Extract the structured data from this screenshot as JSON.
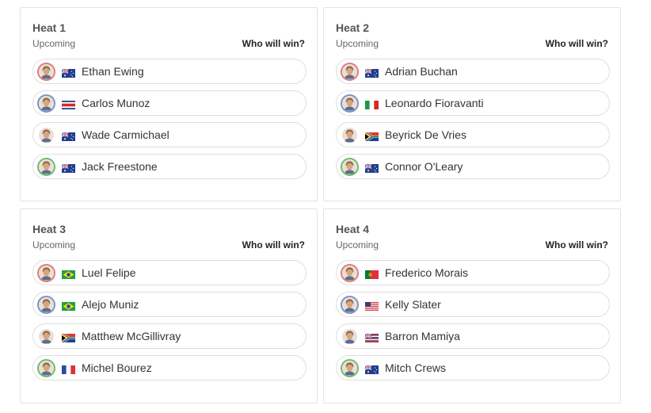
{
  "heats": [
    {
      "title": "Heat 1",
      "status": "Upcoming",
      "prompt": "Who will win?",
      "surfers": [
        {
          "name": "Ethan Ewing",
          "flag": "aus",
          "ring": "r"
        },
        {
          "name": "Carlos Munoz",
          "flag": "crc",
          "ring": "b"
        },
        {
          "name": "Wade Carmichael",
          "flag": "aus",
          "ring": "n"
        },
        {
          "name": "Jack Freestone",
          "flag": "aus",
          "ring": "g"
        }
      ]
    },
    {
      "title": "Heat 2",
      "status": "Upcoming",
      "prompt": "Who will win?",
      "surfers": [
        {
          "name": "Adrian Buchan",
          "flag": "aus",
          "ring": "r"
        },
        {
          "name": "Leonardo Fioravanti",
          "flag": "ita",
          "ring": "b"
        },
        {
          "name": "Beyrick De Vries",
          "flag": "rsa",
          "ring": "n"
        },
        {
          "name": "Connor O'Leary",
          "flag": "aus",
          "ring": "g"
        }
      ]
    },
    {
      "title": "Heat 3",
      "status": "Upcoming",
      "prompt": "Who will win?",
      "surfers": [
        {
          "name": "Luel Felipe",
          "flag": "bra",
          "ring": "r"
        },
        {
          "name": "Alejo Muniz",
          "flag": "bra",
          "ring": "b"
        },
        {
          "name": "Matthew McGillivray",
          "flag": "rsa",
          "ring": "n"
        },
        {
          "name": "Michel Bourez",
          "flag": "fra",
          "ring": "g"
        }
      ]
    },
    {
      "title": "Heat 4",
      "status": "Upcoming",
      "prompt": "Who will win?",
      "surfers": [
        {
          "name": "Frederico Morais",
          "flag": "por",
          "ring": "r"
        },
        {
          "name": "Kelly Slater",
          "flag": "usa",
          "ring": "b"
        },
        {
          "name": "Barron Mamiya",
          "flag": "haw",
          "ring": "n"
        },
        {
          "name": "Mitch Crews",
          "flag": "aus",
          "ring": "g"
        }
      ]
    }
  ],
  "icons": {
    "avatar": "person-avatar-icon",
    "flag": "country-flag-icon"
  }
}
